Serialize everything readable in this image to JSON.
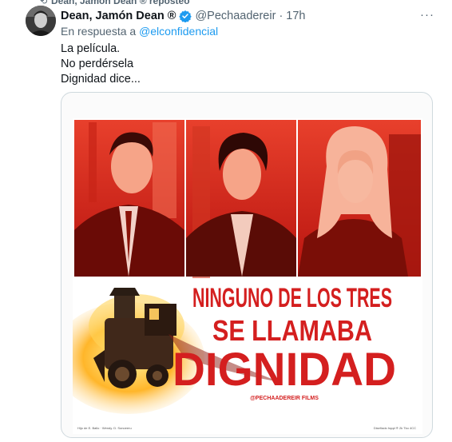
{
  "repost": {
    "text": "Dean, Jamón Dean ® reposteó"
  },
  "tweet": {
    "display_name": "Dean, Jamón Dean ®",
    "handle": "@Pechaadereir",
    "time": "17h",
    "reply_prefix": "En respuesta a",
    "reply_handle": "@elconfidencial",
    "lines": [
      "La película.",
      "No perdérsela",
      "Dignidad dice..."
    ]
  },
  "poster": {
    "line1": "NINGUNO DE LOS TRES",
    "line2": "SE LLAMABA",
    "line3": "DIGNIDAD",
    "credit": "@PECHAADEREIR FILMS",
    "small_left": "Hijo de E. Ballo · Wendy. D. Sonoeeru",
    "small_right": "Diseñado hqqd ® 2k Tko 4CC"
  },
  "colors": {
    "accent": "#1d9bf0",
    "poster_red": "#d41f1f",
    "muted": "#536471"
  }
}
